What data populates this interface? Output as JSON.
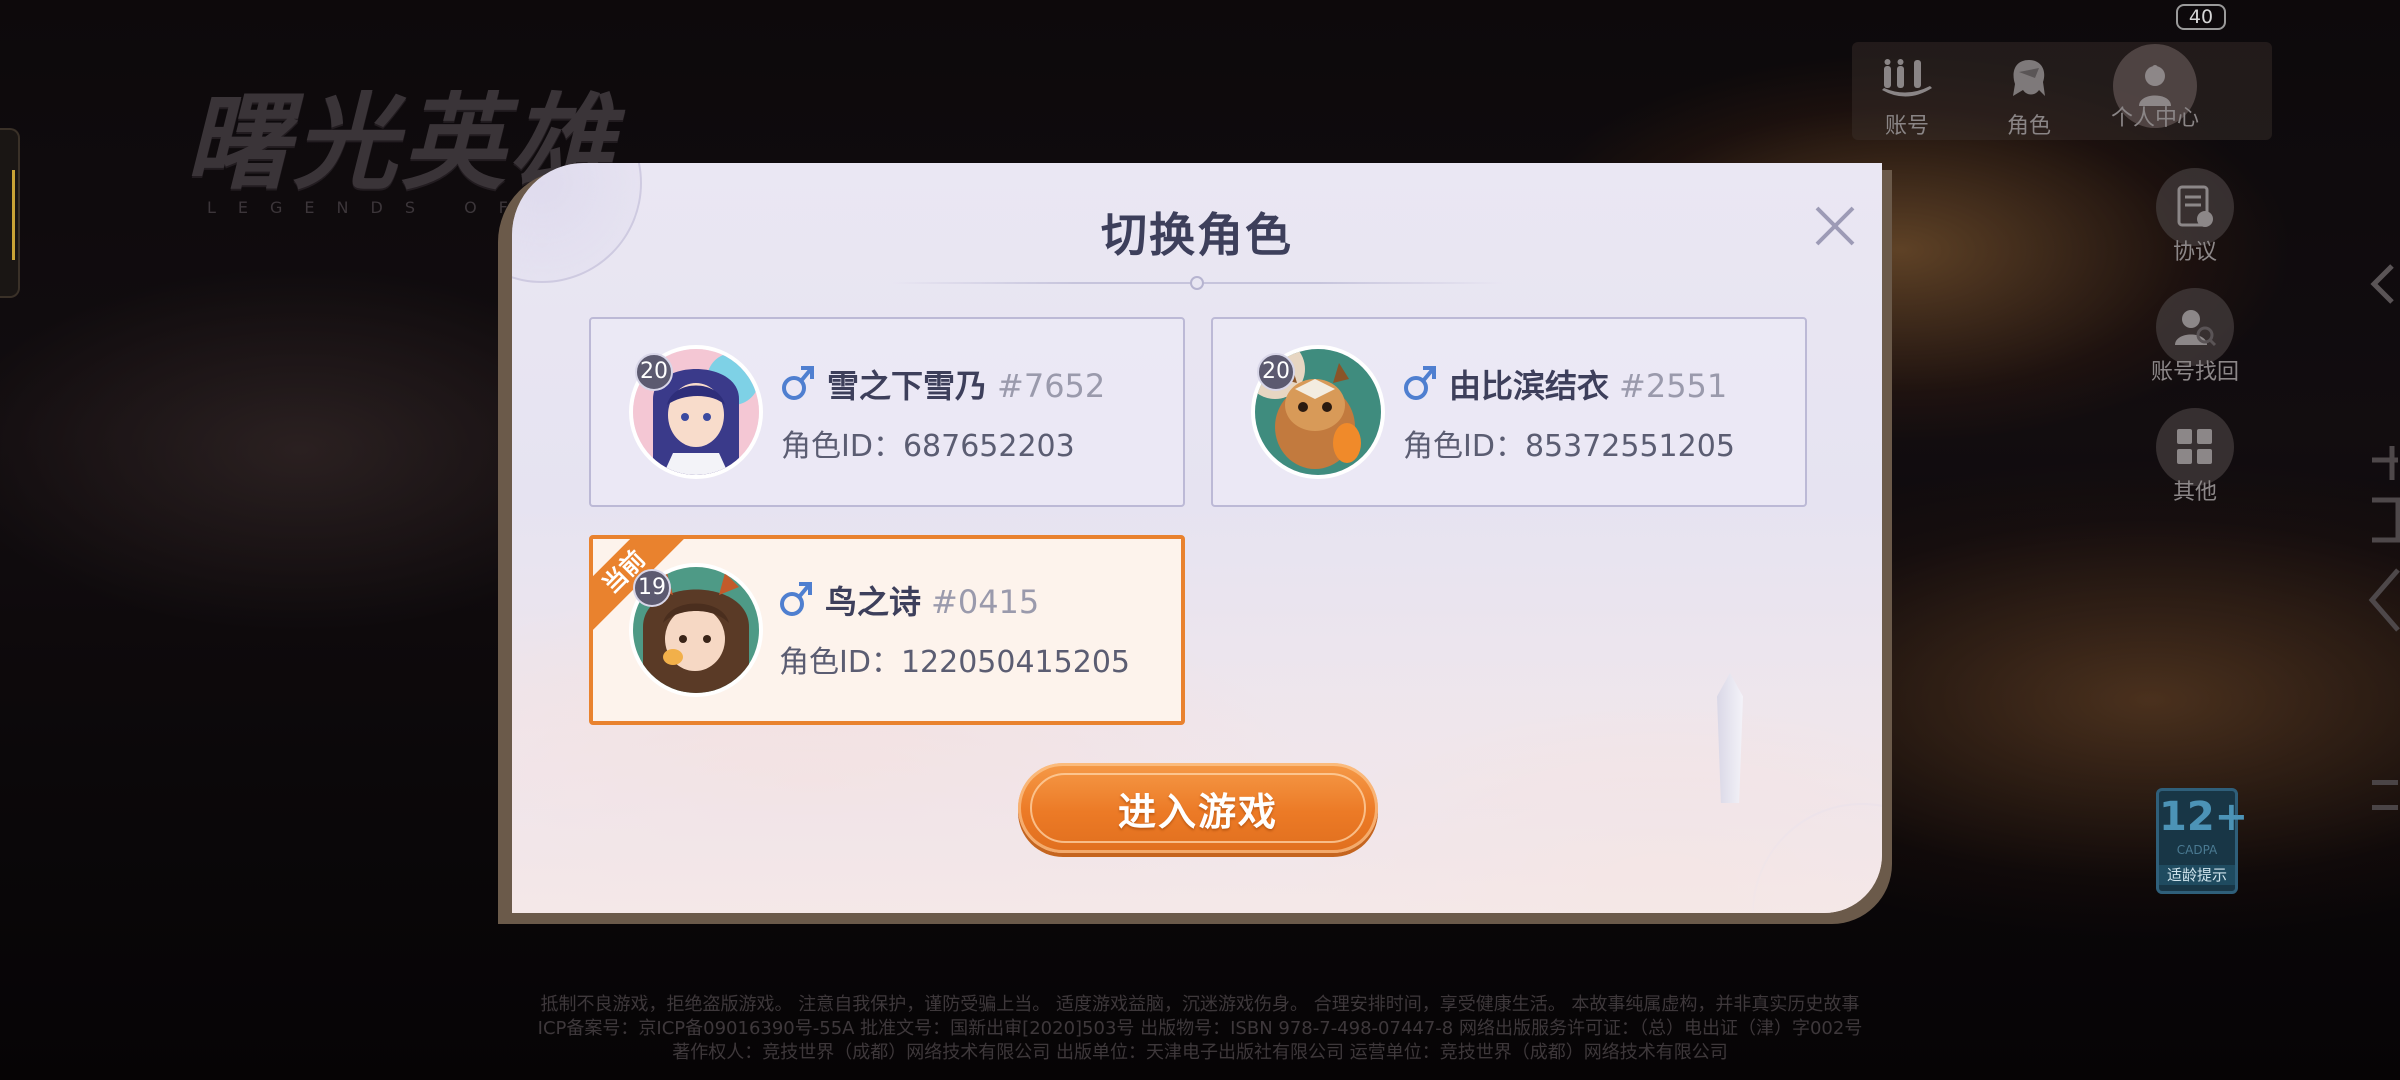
{
  "logo": {
    "title": "曙光英雄",
    "subtitle": "LEGENDS OF"
  },
  "battery": "40",
  "topnav": [
    {
      "label": "账号",
      "icon": "account-icon"
    },
    {
      "label": "角色",
      "icon": "character-icon"
    },
    {
      "label": "个人中心",
      "icon": "profile-icon"
    }
  ],
  "sidenav": [
    {
      "label": "协议",
      "icon": "agreement-icon"
    },
    {
      "label": "账号找回",
      "icon": "account-recovery-icon"
    },
    {
      "label": "其他",
      "icon": "grid-icon"
    }
  ],
  "age_rating": {
    "number": "12+",
    "org": "CADPA",
    "tip": "适龄提示"
  },
  "dialog": {
    "title": "切换角色",
    "current_label": "当前",
    "enter_label": "进入游戏",
    "id_prefix": "角色ID：",
    "roles": [
      {
        "level": "20",
        "name": "雪之下雪乃",
        "tag": "#7652",
        "role_id": "687652203",
        "gender": "male",
        "current": false
      },
      {
        "level": "20",
        "name": "由比滨结衣",
        "tag": "#2551",
        "role_id": "85372551205",
        "gender": "male",
        "current": false
      },
      {
        "level": "19",
        "name": "鸟之诗",
        "tag": "#0415",
        "role_id": "122050415205",
        "gender": "male",
        "current": true
      }
    ]
  },
  "footer": {
    "line1": "抵制不良游戏，拒绝盗版游戏。 注意自我保护，谨防受骗上当。 适度游戏益脑，沉迷游戏伤身。 合理安排时间，享受健康生活。 本故事纯属虚构，并非真实历史故事",
    "line2": "ICP备案号：京ICP备09016390号-55A  批准文号：国新出审[2020]503号  出版物号：ISBN 978-7-498-07447-8  网络出版服务许可证：（总）电出证（津）字002号",
    "line3": "著作权人：竞技世界（成都）网络技术有限公司  出版单位：天津电子出版社有限公司  运营单位：竞技世界（成都）网络技术有限公司"
  },
  "colors": {
    "accent": "#e9822e",
    "title": "#3d3f5b",
    "gender": "#4f7fd0"
  }
}
